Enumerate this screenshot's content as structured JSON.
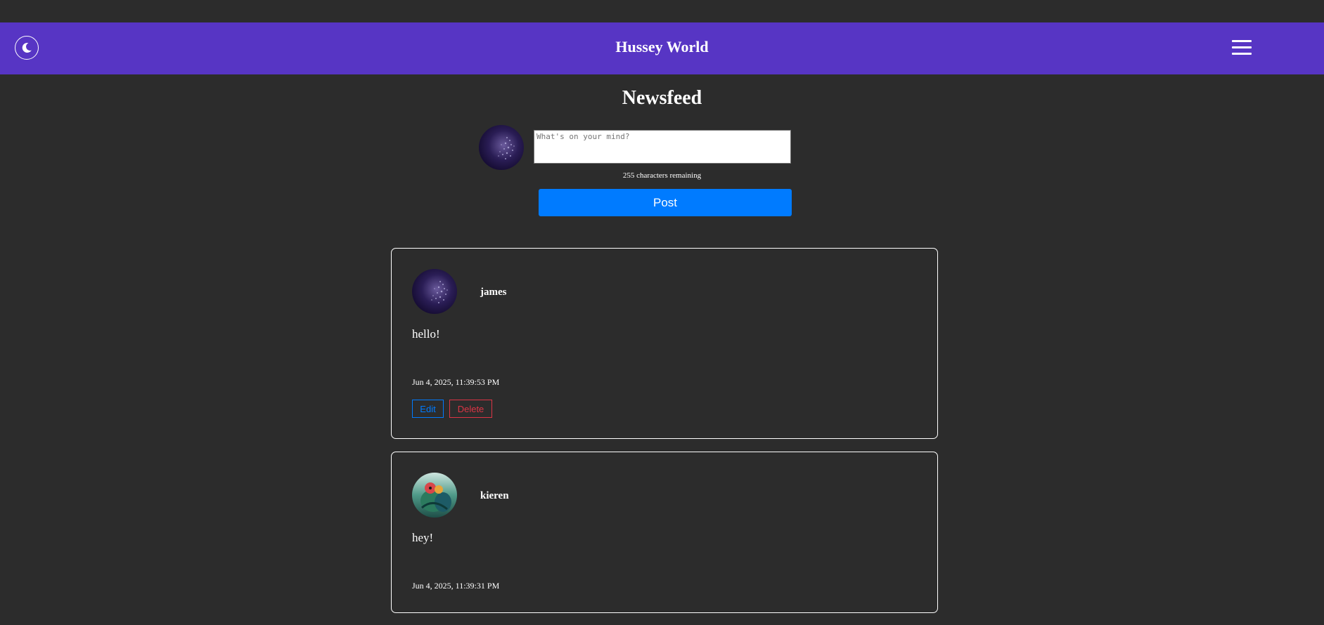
{
  "header": {
    "title": "Hussey World",
    "theme_icon": "moon-icon",
    "menu_icon": "hamburger-menu-icon",
    "brand_color": "#5735c4"
  },
  "page": {
    "heading": "Newsfeed"
  },
  "composer": {
    "placeholder": "What's on your mind?",
    "value": "",
    "char_counter": "255 characters remaining",
    "post_label": "Post"
  },
  "posts": [
    {
      "username": "james",
      "content": "hello!",
      "timestamp": "Jun 4, 2025, 11:39:53 PM",
      "edit_label": "Edit",
      "delete_label": "Delete"
    },
    {
      "username": "kieren",
      "content": "hey!",
      "timestamp": "Jun 4, 2025, 11:39:31 PM"
    }
  ],
  "colors": {
    "background": "#2c2c2c",
    "primary_button": "#007bff",
    "danger": "#dc3545"
  }
}
